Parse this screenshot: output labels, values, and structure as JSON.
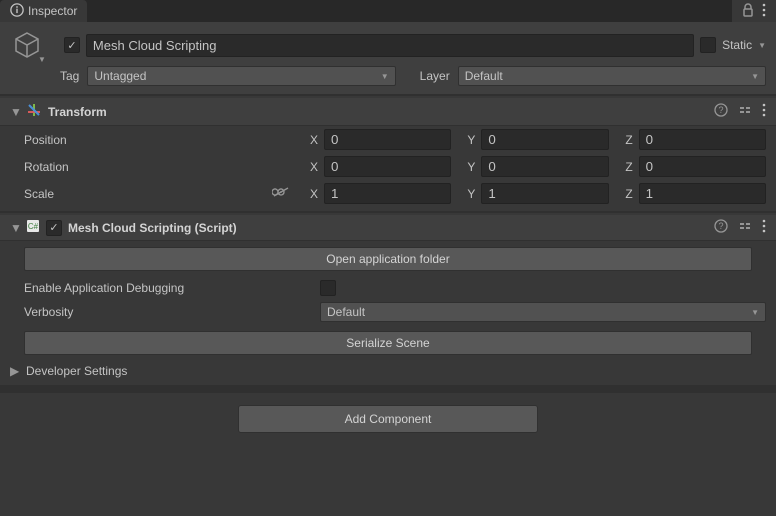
{
  "tab": {
    "title": "Inspector"
  },
  "header": {
    "name": "Mesh Cloud Scripting",
    "static_label": "Static",
    "tag_label": "Tag",
    "tag_value": "Untagged",
    "layer_label": "Layer",
    "layer_value": "Default"
  },
  "transform": {
    "title": "Transform",
    "position_label": "Position",
    "rotation_label": "Rotation",
    "scale_label": "Scale",
    "x_label": "X",
    "y_label": "Y",
    "z_label": "Z",
    "position": {
      "x": "0",
      "y": "0",
      "z": "0"
    },
    "rotation": {
      "x": "0",
      "y": "0",
      "z": "0"
    },
    "scale": {
      "x": "1",
      "y": "1",
      "z": "1"
    }
  },
  "script": {
    "title": "Mesh Cloud Scripting (Script)",
    "open_folder_btn": "Open application folder",
    "enable_debug_label": "Enable Application Debugging",
    "verbosity_label": "Verbosity",
    "verbosity_value": "Default",
    "serialize_btn": "Serialize Scene"
  },
  "dev_settings": {
    "title": "Developer Settings"
  },
  "add_component": "Add Component"
}
